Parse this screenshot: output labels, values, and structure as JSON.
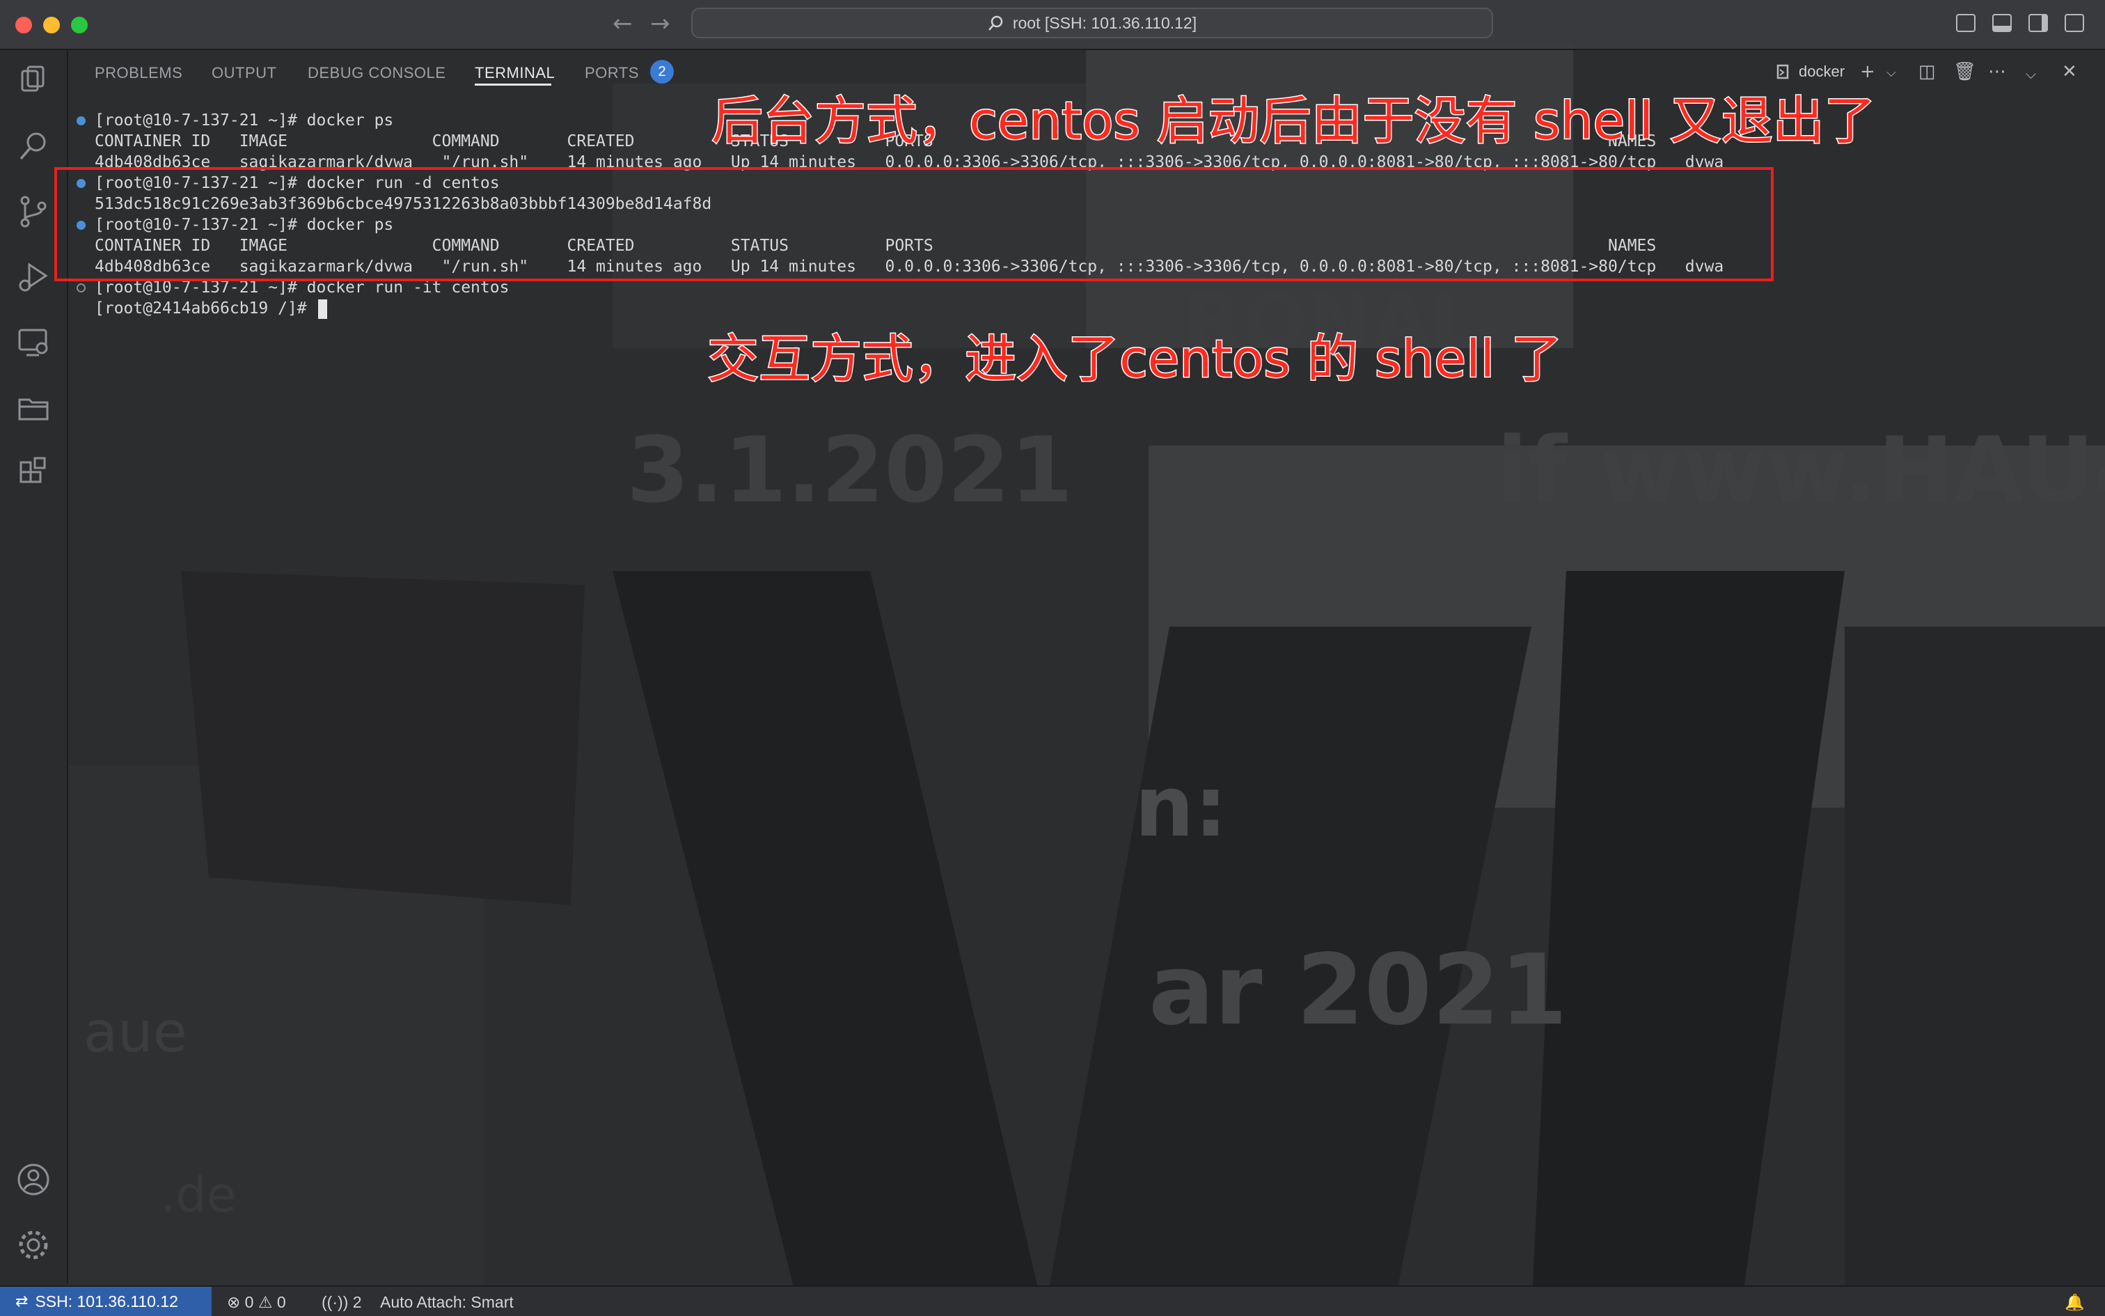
{
  "window": {
    "command_center": "root [SSH: 101.36.110.12]"
  },
  "panel": {
    "tabs": [
      {
        "label": "PROBLEMS"
      },
      {
        "label": "OUTPUT"
      },
      {
        "label": "DEBUG CONSOLE"
      },
      {
        "label": "TERMINAL"
      },
      {
        "label": "PORTS"
      }
    ],
    "active_tab": "TERMINAL",
    "ports_badge": "2",
    "terminal_name": "docker"
  },
  "terminal": {
    "lines": [
      "[root@10-7-137-21 ~]# docker ps",
      "CONTAINER ID   IMAGE               COMMAND       CREATED          STATUS          PORTS                                                                      NAMES",
      "4db408db63ce   sagikazarmark/dvwa   \"/run.sh\"    14 minutes ago   Up 14 minutes   0.0.0.0:3306->3306/tcp, :::3306->3306/tcp, 0.0.0.0:8081->80/tcp, :::8081->80/tcp   dvwa",
      "[root@10-7-137-21 ~]# docker run -d centos",
      "513dc518c91c269e3ab3f369b6cbce4975312263b8a03bbbf14309be8d14af8d",
      "[root@10-7-137-21 ~]# docker ps",
      "CONTAINER ID   IMAGE               COMMAND       CREATED          STATUS          PORTS                                                                      NAMES",
      "4db408db63ce   sagikazarmark/dvwa   \"/run.sh\"    14 minutes ago   Up 14 minutes   0.0.0.0:3306->3306/tcp, :::3306->3306/tcp, 0.0.0.0:8081->80/tcp, :::8081->80/tcp   dvwa",
      "[root@10-7-137-21 ~]# docker run -it centos",
      "[root@2414ab66cb19 /]# "
    ]
  },
  "annotations": {
    "top": "后台方式，centos 启动后由于没有 shell 又退出了",
    "middle": "交互方式，进入了centos 的 shell 了"
  },
  "statusbar": {
    "remote": "SSH: 101.36.110.12",
    "errors": "0",
    "warnings": "0",
    "ports": "2",
    "auto_attach": "Auto Attach: Smart"
  },
  "colors": {
    "accent": "#3a7bd5",
    "remote_bg": "#2f5fa8",
    "annotation": "#ff2a1f"
  }
}
